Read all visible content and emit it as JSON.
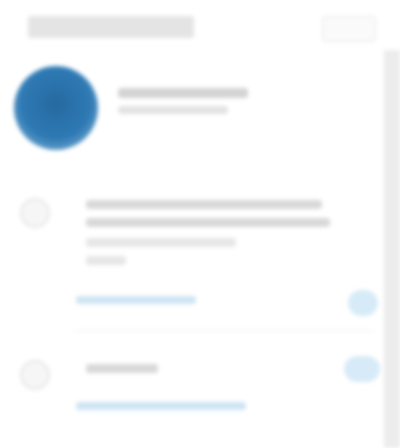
{
  "header": {
    "title": "",
    "action_label": ""
  },
  "profile": {
    "name": "",
    "subtitle": ""
  },
  "items": [
    {
      "icon": "circle-icon",
      "title": "",
      "link": ""
    },
    {
      "icon": "circle-icon",
      "title": "",
      "link": ""
    }
  ],
  "colors": {
    "accent": "#2e79b4",
    "link": "#cde4f2",
    "pill": "#d6ebf7"
  }
}
